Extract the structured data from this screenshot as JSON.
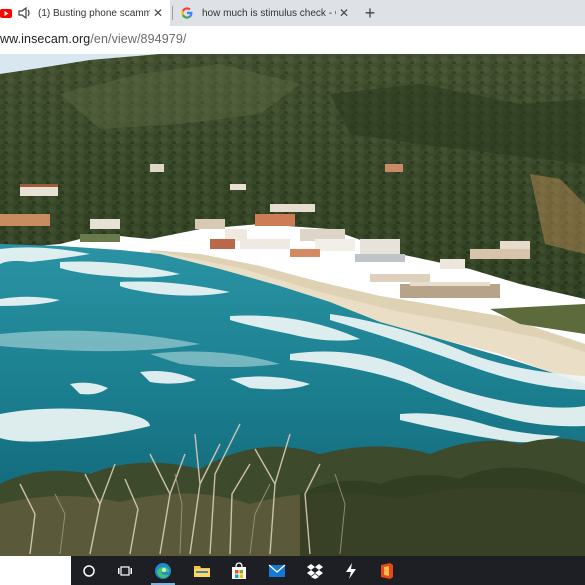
{
  "browser": {
    "tabs": [
      {
        "title": "(1) Busting phone scammer",
        "favicon": "youtube-icon",
        "audio": true
      },
      {
        "title": "how much is stimulus check - Go",
        "favicon": "google-icon",
        "audio": false
      }
    ],
    "new_tab_symbol": "+",
    "close_symbol": "✕",
    "url": {
      "host": "ww.insecam.org",
      "path": "/en/view/894979/"
    }
  },
  "taskbar": {
    "items": [
      "cortana-icon",
      "task-view-icon",
      "edge-icon",
      "file-explorer-icon",
      "store-icon",
      "mail-icon",
      "dropbox-icon",
      "winamp-icon",
      "office-icon"
    ],
    "active_item": "edge-icon"
  },
  "colors": {
    "sea": "#1d8a9a",
    "sea_deep": "#0f6574",
    "hill": "#3c4a2c",
    "sand": "#eadfc8",
    "sky": "#dbeaf2",
    "taskbar_bg": "#1d1f24",
    "tabstrip_bg": "#dee1e6"
  }
}
